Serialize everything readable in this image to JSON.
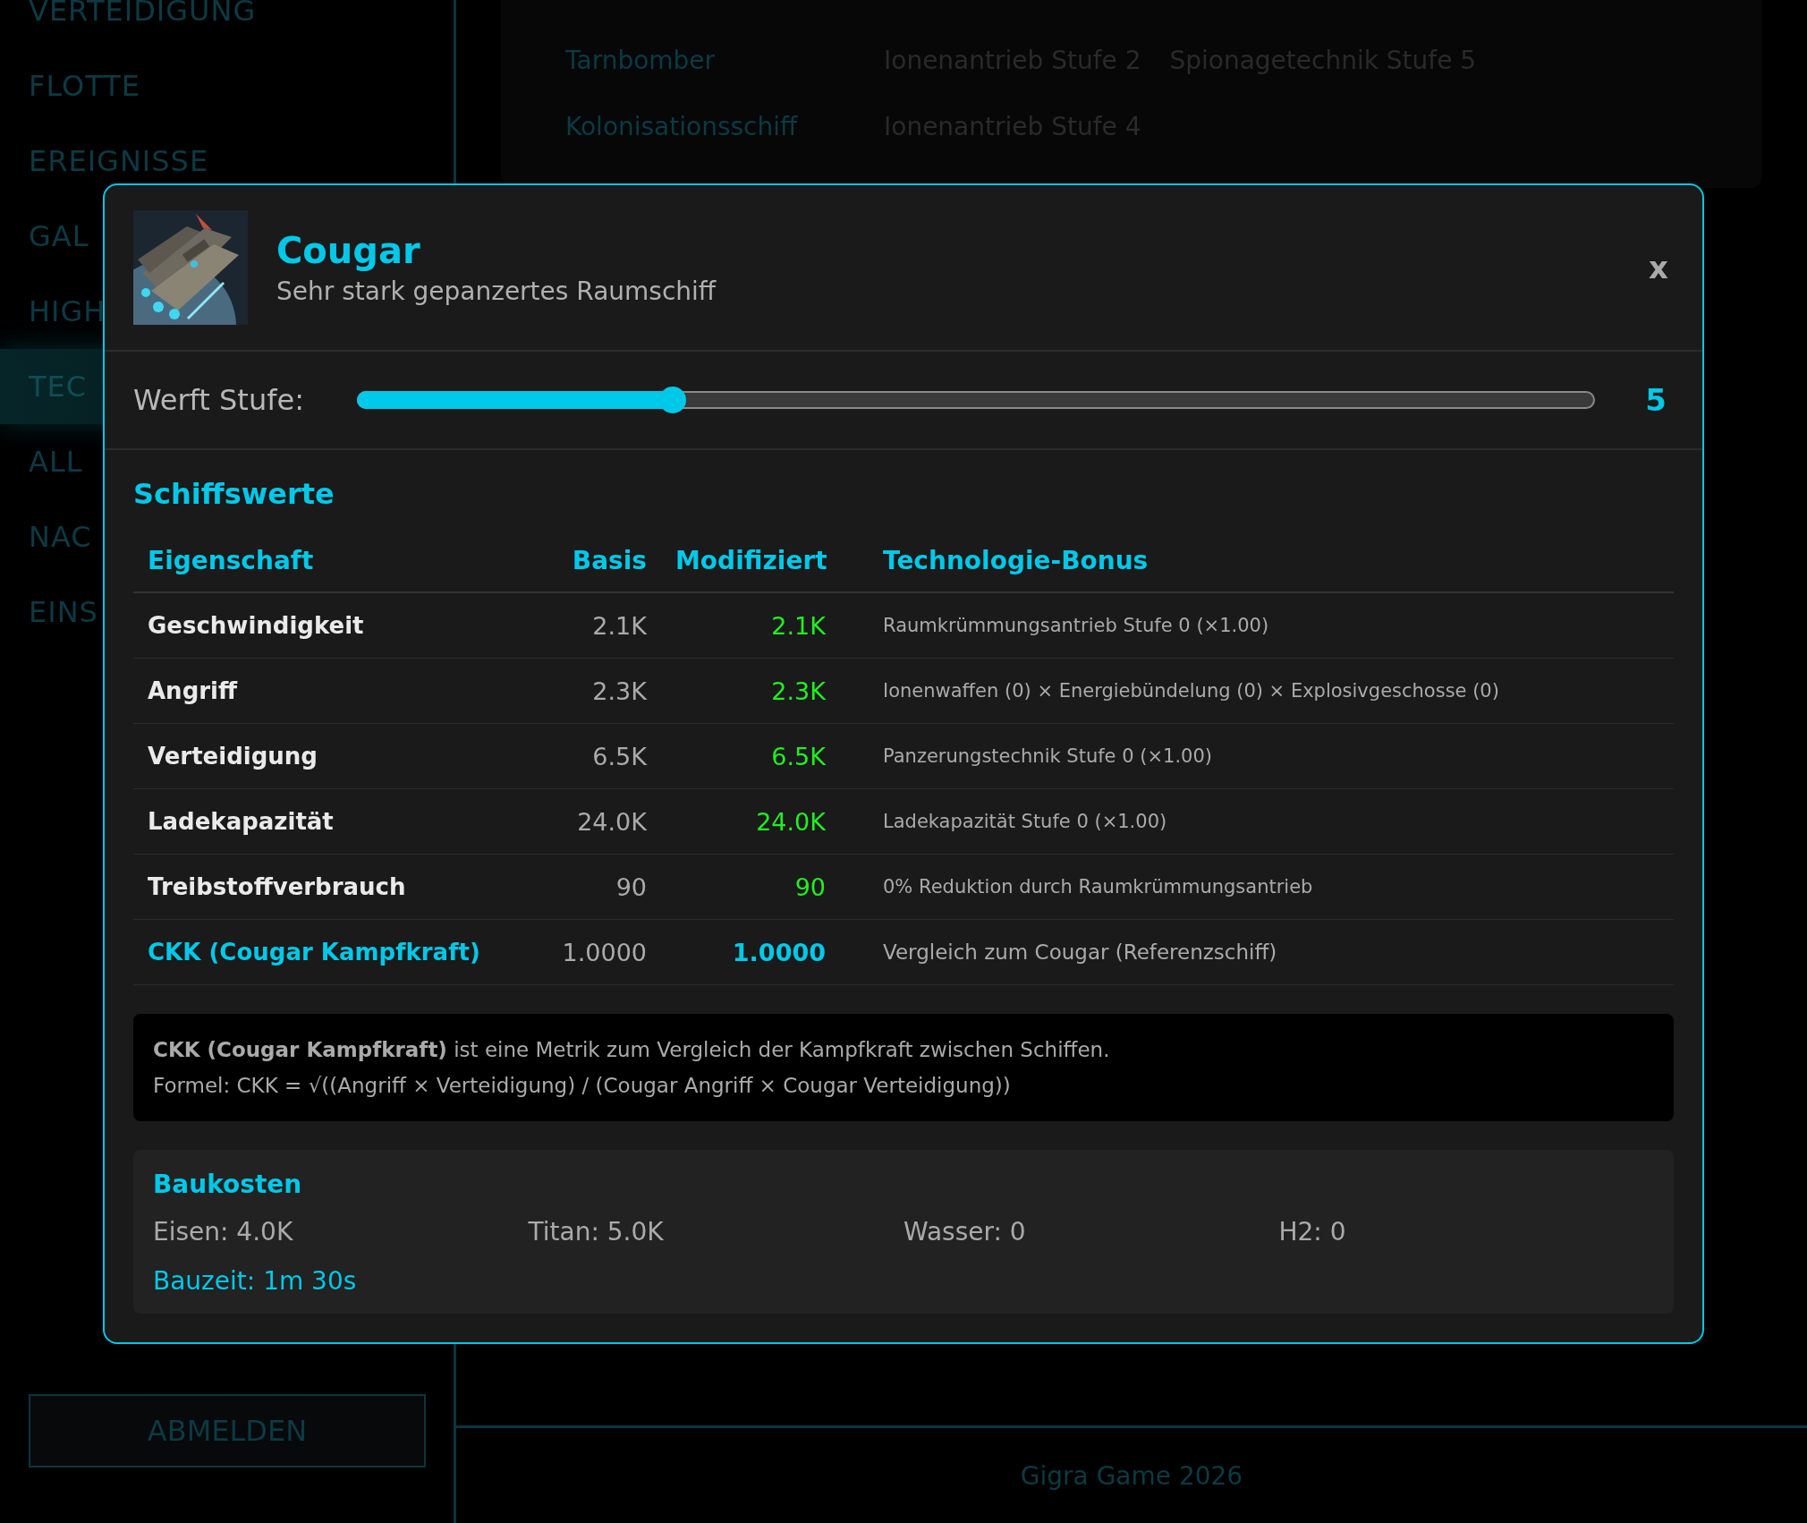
{
  "sidebar": {
    "items": [
      {
        "label": "VERTEIDIGUNG",
        "selected": false
      },
      {
        "label": "FLOTTE",
        "selected": false
      },
      {
        "label": "EREIGNISSE",
        "selected": false
      },
      {
        "label": "GAL",
        "selected": false
      },
      {
        "label": "HIGH",
        "selected": false
      },
      {
        "label": "TEC",
        "selected": true
      },
      {
        "label": "ALL",
        "selected": false
      },
      {
        "label": "NAC",
        "selected": false
      },
      {
        "label": "EINS",
        "selected": false
      }
    ],
    "logout_button": "ABMELDEN"
  },
  "background_table": {
    "rows": [
      {
        "cells": [
          "Tarnbomber",
          "Ionenantrieb Stufe 2",
          "Spionagetechnik Stufe 5"
        ]
      },
      {
        "cells": [
          "Kolonisationsschiff",
          "Ionenantrieb Stufe 4"
        ]
      }
    ]
  },
  "modal": {
    "title": "Cougar",
    "subtitle": "Sehr stark gepanzertes Raumschiff",
    "close": "x",
    "shipyard": {
      "label": "Werft Stufe:",
      "level": 0.255,
      "value": "5"
    },
    "stats": {
      "heading": "Schiffswerte",
      "columns": [
        "Eigenschaft",
        "Basis",
        "Modifiziert",
        "Technologie-Bonus"
      ],
      "rows": [
        {
          "kind": "stat",
          "name": "Geschwindigkeit",
          "base": "2.1K",
          "modified": "2.1K",
          "bonus": "Raumkrümmungsantrieb Stufe 0 (×1.00)"
        },
        {
          "kind": "stat",
          "name": "Angriff",
          "base": "2.3K",
          "modified": "2.3K",
          "bonus": "Ionenwaffen (0) × Energiebündelung (0) × Explosivgeschosse (0)"
        },
        {
          "kind": "stat",
          "name": "Verteidigung",
          "base": "6.5K",
          "modified": "6.5K",
          "bonus": "Panzerungstechnik Stufe 0 (×1.00)"
        },
        {
          "kind": "stat",
          "name": "Ladekapazität",
          "base": "24.0K",
          "modified": "24.0K",
          "bonus": "Ladekapazität Stufe 0 (×1.00)"
        },
        {
          "kind": "stat",
          "name": "Treibstoffverbrauch",
          "base": "90",
          "modified": "90",
          "bonus": "0% Reduktion durch Raumkrümmungsantrieb"
        },
        {
          "kind": "metric",
          "name": "CKK (Cougar Kampfkraft)",
          "base": "1.0000",
          "modified": "1.0000",
          "bonus": "Vergleich zum Cougar (Referenzschiff)"
        }
      ]
    },
    "info": [
      "**CKK (Cougar Kampfkraft)** ist eine Metrik zum Vergleich der Kampfkraft zwischen Schiffen.",
      "Formel: CKK = √((Angriff × Verteidigung) / (Cougar Angriff × Cougar Verteidigung))"
    ],
    "costs": {
      "heading": "Baukosten",
      "items": [
        "Eisen: 4.0K",
        "Titan: 5.0K",
        "Wasser: 0",
        "H2: 0"
      ],
      "build_time": "Bauzeit: 1m 30s"
    }
  },
  "footer": "Gigra Game 2026"
}
